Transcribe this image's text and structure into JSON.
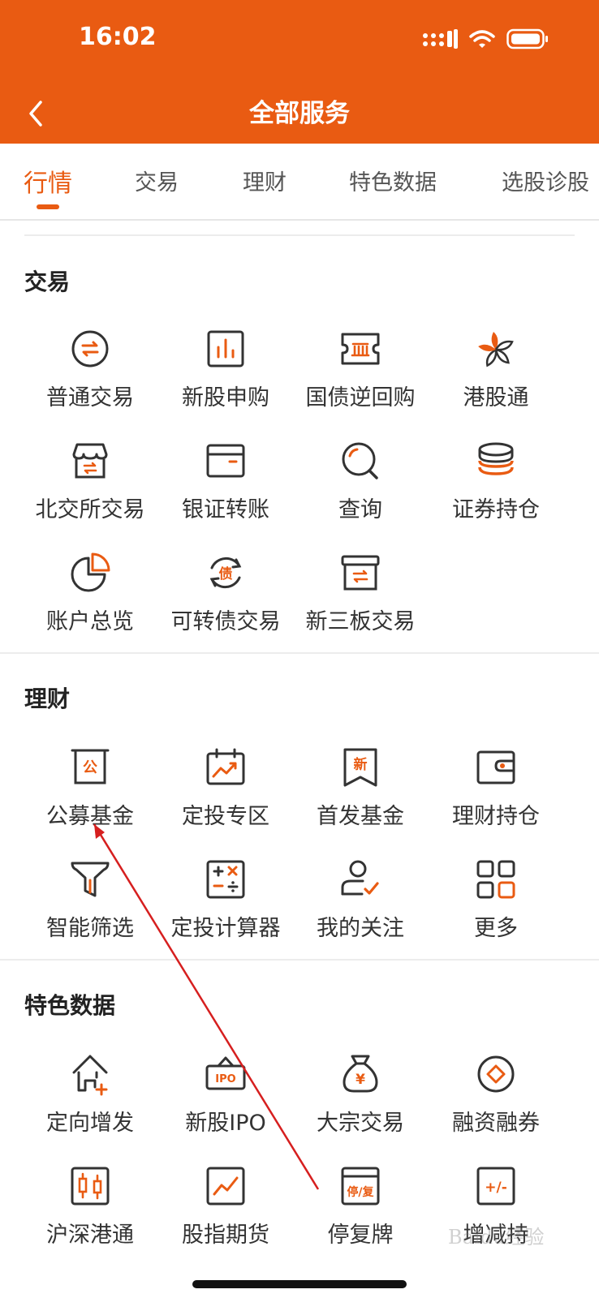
{
  "status": {
    "time": "16:02"
  },
  "header": {
    "title": "全部服务"
  },
  "tabs": [
    "行情",
    "交易",
    "理财",
    "特色数据",
    "选股诊股"
  ],
  "sections": {
    "trade": {
      "title": "交易",
      "items": [
        "普通交易",
        "新股申购",
        "国债逆回购",
        "港股通",
        "北交所交易",
        "银证转账",
        "查询",
        "证券持仓",
        "账户总览",
        "可转债交易",
        "新三板交易"
      ]
    },
    "finance": {
      "title": "理财",
      "items": [
        "公募基金",
        "定投专区",
        "首发基金",
        "理财持仓",
        "智能筛选",
        "定投计算器",
        "我的关注",
        "更多"
      ]
    },
    "special": {
      "title": "特色数据",
      "items": [
        "定向增发",
        "新股IPO",
        "大宗交易",
        "融资融券",
        "沪深港通",
        "股指期货",
        "停复牌",
        "增减持"
      ]
    }
  },
  "icon_glyphs": {
    "gong": "公",
    "xin": "新",
    "zhai": "债",
    "ipo": "IPO",
    "yen": "¥",
    "tingfu": "停/复",
    "plusminus": "+/-"
  },
  "watermark": "Baidu经验",
  "colors": {
    "accent": "#E95B12",
    "text": "#333333",
    "icon_stroke": "#333333"
  }
}
